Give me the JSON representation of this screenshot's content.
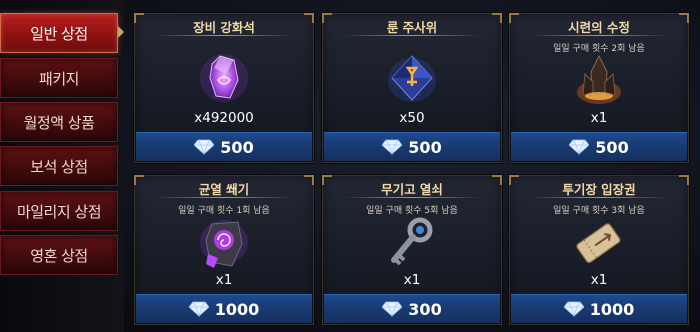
{
  "sidebar": {
    "tabs": [
      {
        "label": "일반 상점",
        "active": true
      },
      {
        "label": "패키지",
        "active": false
      },
      {
        "label": "월정액 상품",
        "active": false
      },
      {
        "label": "보석 상점",
        "active": false
      },
      {
        "label": "마일리지 상점",
        "active": false
      },
      {
        "label": "영혼 상점",
        "active": false
      }
    ]
  },
  "items": [
    {
      "title": "장비 강화석",
      "limit": "",
      "quantity": "x492000",
      "price": "500",
      "icon": "purple-crystal-icon"
    },
    {
      "title": "룬 주사위",
      "limit": "",
      "quantity": "x50",
      "price": "500",
      "icon": "rune-dice-icon"
    },
    {
      "title": "시련의 수정",
      "limit": "일일 구매 횟수 2회 남음",
      "quantity": "x1",
      "price": "500",
      "icon": "trial-crystal-icon"
    },
    {
      "title": "균열 쐐기",
      "limit": "일일 구매 횟수 1회 남음",
      "quantity": "x1",
      "price": "1000",
      "icon": "rift-wedge-icon"
    },
    {
      "title": "무기고 열쇠",
      "limit": "일일 구매 횟수 5회 남음",
      "quantity": "x1",
      "price": "300",
      "icon": "armory-key-icon"
    },
    {
      "title": "투기장 입장권",
      "limit": "일일 구매 횟수 3회 남음",
      "quantity": "x1",
      "price": "1000",
      "icon": "arena-ticket-icon"
    }
  ],
  "colors": {
    "accent_gold": "#f3d9a4",
    "price_bar": "#1a3c75",
    "tab_active": "#b71c1c",
    "tab_inactive": "#4a0c0f"
  }
}
